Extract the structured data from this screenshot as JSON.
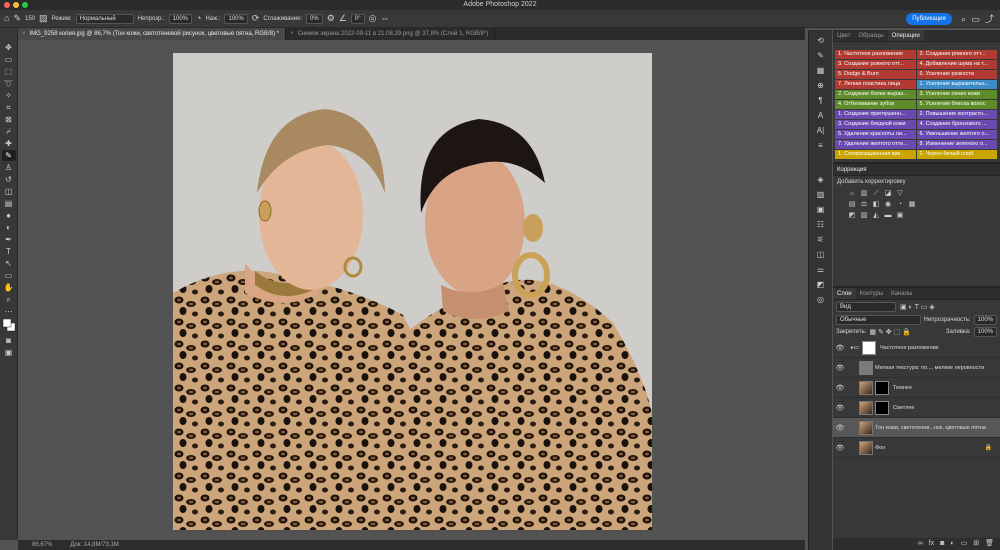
{
  "app": {
    "title": "Adobe Photoshop 2022"
  },
  "options": {
    "brush_size": "150",
    "mode_label": "Режим:",
    "mode_value": "Нормальный",
    "opacity_label": "Непрозр.:",
    "opacity_value": "100%",
    "pressure_label": "Наж.:",
    "pressure_value": "100%",
    "smoothing_label": "Сглаживание:",
    "smoothing_value": "0%",
    "angle_value": "0°",
    "publish_label": "Публикация"
  },
  "documents": {
    "tabs": [
      {
        "label": "IMG_9258 копия.jpg @ 86,7% (Тон кожи, светотеневой рисунок, цветовые пятна, RGB/8) *",
        "active": true
      },
      {
        "label": "Снимок экрана 2022-09-11 в 21.08.29.png @ 37,8% (Слой 1, RGB/8*)",
        "active": false
      }
    ]
  },
  "status": {
    "zoom": "86,67%",
    "doc": "Док: 14,8M/73,1M"
  },
  "panels": {
    "top_tabs": [
      "Цвет",
      "Образцы",
      "Операции"
    ],
    "actions": [
      {
        "label": "1. Частотное разложение",
        "color": "#b13a32"
      },
      {
        "label": "2. Создание ровного отт...",
        "color": "#b13a32"
      },
      {
        "label": "3. Создание ровного отт...",
        "color": "#b13a32"
      },
      {
        "label": "4. Добавление шума на т...",
        "color": "#b13a32"
      },
      {
        "label": "5. Dodge & Burn",
        "color": "#b13a32"
      },
      {
        "label": "6. Усиление резкости",
        "color": "#b13a32"
      },
      {
        "label": "7. Легкая пластика лица",
        "color": "#b13a32"
      },
      {
        "label": "1. Усиление выразительн...",
        "color": "#3c8cc8"
      },
      {
        "label": "2. Создание более выраз...",
        "color": "#5f8c2a"
      },
      {
        "label": "3. Усиление синих кожи",
        "color": "#5f8c2a"
      },
      {
        "label": "4. Отбеливание зубов",
        "color": "#5f8c2a"
      },
      {
        "label": "5. Усиление блеска волос",
        "color": "#5f8c2a"
      },
      {
        "label": "1. Создание приглушенн...",
        "color": "#6a4ab0"
      },
      {
        "label": "2. Повышение контрастн...",
        "color": "#6a4ab0"
      },
      {
        "label": "3. Создание бледной кожи",
        "color": "#6a4ab0"
      },
      {
        "label": "4. Создание бронзового ...",
        "color": "#6a4ab0"
      },
      {
        "label": "5. Удаление красноты ли...",
        "color": "#6a4ab0"
      },
      {
        "label": "6. Уменьшение желтого о...",
        "color": "#6a4ab0"
      },
      {
        "label": "7. Удаление желтого отте...",
        "color": "#6a4ab0"
      },
      {
        "label": "8. Изменение зеленого о...",
        "color": "#6a4ab0"
      },
      {
        "label": "1. Соляризационная кри...",
        "color": "#c9a300"
      },
      {
        "label": "2. Черно-белый слой",
        "color": "#c9a300"
      }
    ],
    "adjustments": {
      "title": "Коррекция",
      "subtitle": "Добавить корректировку"
    },
    "layers": {
      "tabs": [
        "Слои",
        "Контуры",
        "Каналы"
      ],
      "filter": "Вид",
      "blend": "Обычные",
      "opacity_label": "Непрозрачность:",
      "opacity_value": "100%",
      "lock_label": "Закрепить:",
      "fill_label": "Заливка:",
      "fill_value": "100%",
      "items": [
        {
          "name": "Частотное разложение",
          "type": "group"
        },
        {
          "name": "Мелкая текстура: по..., мелкие неровности",
          "type": "gray"
        },
        {
          "name": "Темнее",
          "type": "masked"
        },
        {
          "name": "Светлее",
          "type": "masked"
        },
        {
          "name": "Тон кожи, светотенев...нок, цветовые пятна",
          "type": "photo",
          "selected": true
        },
        {
          "name": "Фон",
          "type": "background"
        }
      ]
    }
  }
}
